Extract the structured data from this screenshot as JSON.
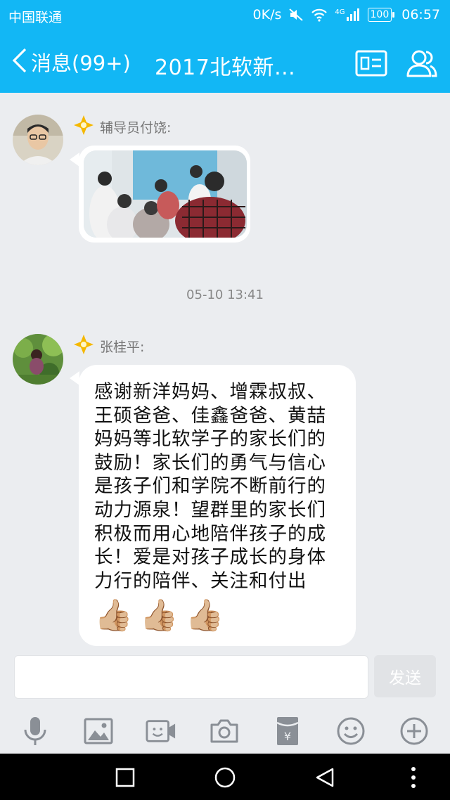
{
  "status_bar": {
    "carrier": "中国联通",
    "net_speed": "0K/s",
    "signal_label": "4G",
    "battery": "100",
    "time": "06:57"
  },
  "header": {
    "back_label": "消息(99+)",
    "title": "2017北软新…",
    "icons": [
      "profile-card-icon",
      "group-members-icon"
    ]
  },
  "messages": [
    {
      "sender": "辅导员付饶:",
      "type": "image"
    },
    {
      "timestamp": "05-10 13:41"
    },
    {
      "sender": "张桂平:",
      "type": "text",
      "text": "感谢新洋妈妈、增霖叔叔、王硕爸爸、佳鑫爸爸、黄喆妈妈等北软学子的家长们的鼓励！家长们的勇气与信心是孩子们和学院不断前行的动力源泉！望群里的家长们积极而用心地陪伴孩子的成长！爱是对孩子成长的身体力行的陪伴、关注和付出",
      "emojis": [
        "👍🏼",
        "👍🏼",
        "👍🏼"
      ]
    }
  ],
  "composer": {
    "input_value": "",
    "send_label": "发送"
  },
  "toolbar_icons": [
    "microphone-icon",
    "image-icon",
    "video-call-icon",
    "camera-icon",
    "red-packet-icon",
    "emoji-icon",
    "plus-icon"
  ],
  "colors": {
    "accent": "#12b7f5",
    "background": "#ebedf0",
    "bubble": "#ffffff",
    "badge_gold": "#f5b800"
  }
}
